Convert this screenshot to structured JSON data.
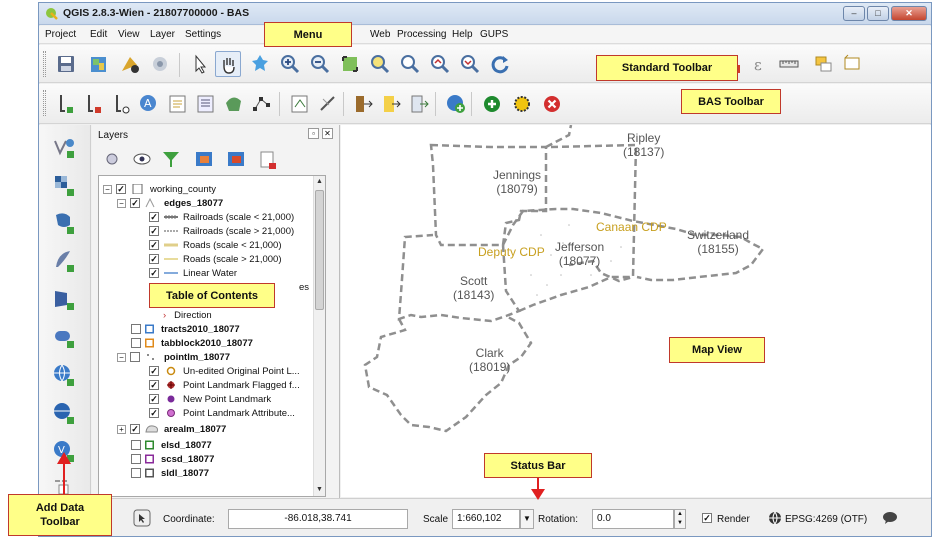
{
  "window": {
    "title": "QGIS 2.8.3-Wien - 21807700000 - BAS"
  },
  "menu": [
    "Project",
    "Edit",
    "View",
    "Layer",
    "Settings",
    "Web",
    "Processing",
    "Help",
    "GUPS"
  ],
  "icons": {
    "standard_toolbar": [
      "save-project-icon",
      "new-map-icon",
      "pan-to-selection-icon",
      "touch-zoom-icon",
      "identify-icon",
      "pan-hand-icon",
      "pan-map-icon",
      "zoom-in-icon",
      "zoom-out-icon",
      "zoom-full-icon",
      "zoom-to-selection-icon",
      "zoom-to-layer-icon",
      "zoom-last-icon",
      "zoom-next-icon",
      "refresh-icon",
      "select-features-icon",
      "expression-icon",
      "measure-icon",
      "annotation-icon",
      "text-annotation-icon"
    ],
    "bas_toolbar": [
      "bas-edges-icon",
      "bas-area-icon",
      "bas-point-icon",
      "bas-label-icon",
      "bas-form-icon",
      "bas-edit-icon",
      "bas-shape-icon",
      "bas-node-icon",
      "bas-review-icon",
      "bas-validate-icon",
      "bas-export-icon",
      "bas-import-icon",
      "bas-package-icon",
      "bas-add-icon",
      "bas-plus-icon",
      "bas-flag-icon",
      "bas-delete-icon"
    ],
    "add_data_toolbar": [
      "add-vector-layer-icon",
      "add-raster-layer-icon",
      "add-postgis-layer-icon",
      "add-spatialite-layer-icon",
      "add-mssql-layer-icon",
      "add-oracle-layer-icon",
      "add-wms-layer-icon",
      "add-wcs-layer-icon",
      "add-wfs-layer-icon",
      "add-delimited-text-icon"
    ]
  },
  "layers_panel": {
    "title": "Layers",
    "items": [
      {
        "label": "working_county",
        "bold": false
      },
      {
        "label": "edges_18077",
        "bold": true
      },
      {
        "label": "Railroads (scale < 21,000)",
        "bold": false
      },
      {
        "label": "Railroads (scale > 21,000)",
        "bold": false
      },
      {
        "label": "Roads (scale < 21,000)",
        "bold": false
      },
      {
        "label": "Roads (scale > 21,000)",
        "bold": false
      },
      {
        "label": "Linear Water",
        "bold": false
      },
      {
        "label": "es",
        "bold": false
      },
      {
        "label": "Direction",
        "bold": false
      },
      {
        "label": "tracts2010_18077",
        "bold": true
      },
      {
        "label": "tabblock2010_18077",
        "bold": true
      },
      {
        "label": "pointlm_18077",
        "bold": true
      },
      {
        "label": "Un-edited Original Point L...",
        "bold": false
      },
      {
        "label": "Point Landmark Flagged f...",
        "bold": false
      },
      {
        "label": "New Point Landmark",
        "bold": false
      },
      {
        "label": "Point Landmark Attribute...",
        "bold": false
      },
      {
        "label": "arealm_18077",
        "bold": true
      },
      {
        "label": "elsd_18077",
        "bold": true
      },
      {
        "label": "scsd_18077",
        "bold": true
      },
      {
        "label": "sldl_18077",
        "bold": true
      }
    ]
  },
  "map": {
    "counties": [
      {
        "name": "Ripley",
        "code": "(18137)"
      },
      {
        "name": "Jennings",
        "code": "(18079)"
      },
      {
        "name": "Switzerland",
        "code": "(18155)"
      },
      {
        "name": "Jefferson",
        "code": "(18077)"
      },
      {
        "name": "Scott",
        "code": "(18143)"
      },
      {
        "name": "Clark",
        "code": "(18019)"
      }
    ],
    "places": [
      "Canaan CDP",
      "Deputy CDP"
    ],
    "label_color": "#c8a020",
    "county_label_color": "#555555"
  },
  "status": {
    "coordinate_label": "Coordinate:",
    "coordinate": "-86.018,38.741",
    "scale_label": "Scale",
    "scale": "1:660,102",
    "rotation_label": "Rotation:",
    "rotation": "0.0",
    "render_label": "Render",
    "epsg": "EPSG:4269 (OTF)"
  },
  "callouts": {
    "menu": "Menu",
    "standard_toolbar": "Standard Toolbar",
    "bas_toolbar": "BAS Toolbar",
    "toc": "Table of Contents",
    "map_view": "Map View",
    "status_bar": "Status Bar",
    "add_data": "Add Data Toolbar"
  }
}
